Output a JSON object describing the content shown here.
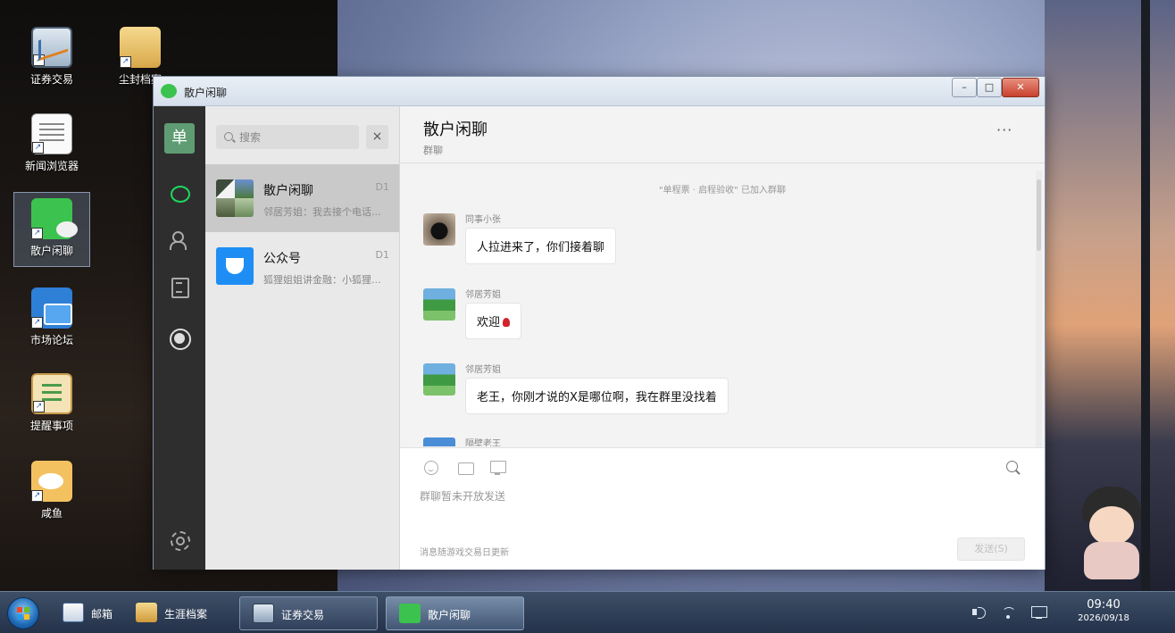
{
  "desktop": {
    "icons": [
      {
        "label": "证券交易",
        "icon": "trading-chart-icon"
      },
      {
        "label": "尘封档案",
        "icon": "archive-folder-icon"
      },
      {
        "label": "新闻浏览器",
        "icon": "news-document-icon"
      },
      {
        "label": "散户闲聊",
        "icon": "chat-bubble-icon"
      },
      {
        "label": "市场论坛",
        "icon": "forum-icon"
      },
      {
        "label": "提醒事项",
        "icon": "clipboard-icon"
      },
      {
        "label": "咸鱼",
        "icon": "fish-icon"
      }
    ]
  },
  "window": {
    "title": "散户闲聊",
    "buttons": {
      "minimize": "–",
      "maximize": "□",
      "close": "✕"
    }
  },
  "rail": {
    "avatar_text": "单",
    "items": [
      "chat-icon",
      "contacts-icon",
      "articles-icon",
      "moments-icon",
      "settings-icon"
    ],
    "accent_color": "#1ed761"
  },
  "sidebar": {
    "search_placeholder": "搜索",
    "clear_label": "×",
    "conversations": [
      {
        "name": "散户闲聊",
        "time": "D1",
        "preview": "邻居芳姐：我去接个电话...",
        "active": true
      },
      {
        "name": "公众号",
        "time": "D1",
        "preview": "狐狸姐姐讲金融：小狐狸...",
        "active": false
      }
    ]
  },
  "chat": {
    "title": "散户闲聊",
    "subtitle": "群聊",
    "more_label": "···",
    "system_note": "\"单程票 · 启程验收\" 已加入群聊",
    "messages": [
      {
        "sender": "同事小张",
        "text": "人拉进来了，你们接着聊"
      },
      {
        "sender": "邻居芳姐",
        "text": "欢迎"
      },
      {
        "sender": "邻居芳姐",
        "text": "老王，你刚才说的X是哪位啊，我在群里没找着"
      },
      {
        "sender": "隔壁老王",
        "text": ""
      }
    ],
    "composer": {
      "placeholder": "群聊暂未开放发送",
      "note": "消息随游戏交易日更新",
      "send_label": "发送(S)"
    }
  },
  "taskbar": {
    "pinned": [
      {
        "label": "邮箱",
        "icon": "mail-icon"
      },
      {
        "label": "生涯档案",
        "icon": "folder-icon"
      }
    ],
    "windows": [
      {
        "label": "证券交易",
        "icon": "trading-chart-icon",
        "active": false
      },
      {
        "label": "散户闲聊",
        "icon": "chat-bubble-icon",
        "active": true
      }
    ],
    "clock": {
      "time": "09:40",
      "date": "2026/09/18"
    }
  }
}
